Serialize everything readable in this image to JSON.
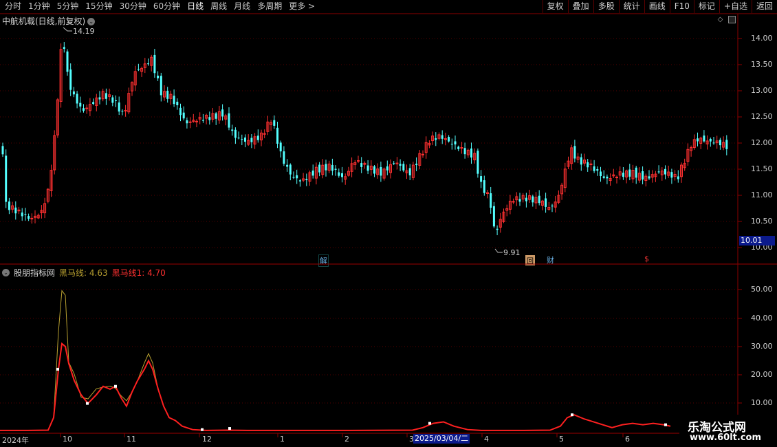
{
  "toolbar": {
    "timeframes": [
      "分时",
      "1分钟",
      "5分钟",
      "15分钟",
      "30分钟",
      "60分钟",
      "日线",
      "周线",
      "月线",
      "多周期",
      "更多 >"
    ],
    "active": "日线",
    "buttons": [
      "复权",
      "叠加",
      "多股",
      "统计",
      "画线",
      "F10",
      "标记",
      "+自选",
      "返回"
    ]
  },
  "stock": {
    "title": "中航机载(日线,前复权)",
    "high_label": "14.19",
    "low_label": "9.91",
    "current_price": "10.01",
    "price_axis": [
      "14.00",
      "13.50",
      "13.00",
      "12.50",
      "12.00",
      "11.50",
      "11.00",
      "10.50",
      "10.00"
    ],
    "markers": {
      "jie": "解",
      "hui": "回",
      "cai": "财",
      "s": "$"
    }
  },
  "indicator": {
    "name": "股朋指标网",
    "line1_label": "黑马线: 4.63",
    "line2_label": "黑马线1: 4.70",
    "axis": [
      "50.00",
      "40.00",
      "30.00",
      "20.00",
      "10.00"
    ],
    "line1_color": "#b8a030",
    "line2_color": "#ff2020"
  },
  "xaxis": {
    "labels": [
      "2024年",
      "10",
      "11",
      "12",
      "1",
      "2",
      "3",
      "4",
      "5",
      "6"
    ],
    "cursor_date": "2025/03/04/二"
  },
  "watermark": {
    "line1": "乐淘公式网",
    "line2": "www.60lt.com"
  },
  "colors": {
    "up": "#ff3030",
    "down": "#54ffff",
    "grid": "#5a0000",
    "axis": "#8b0000"
  }
}
